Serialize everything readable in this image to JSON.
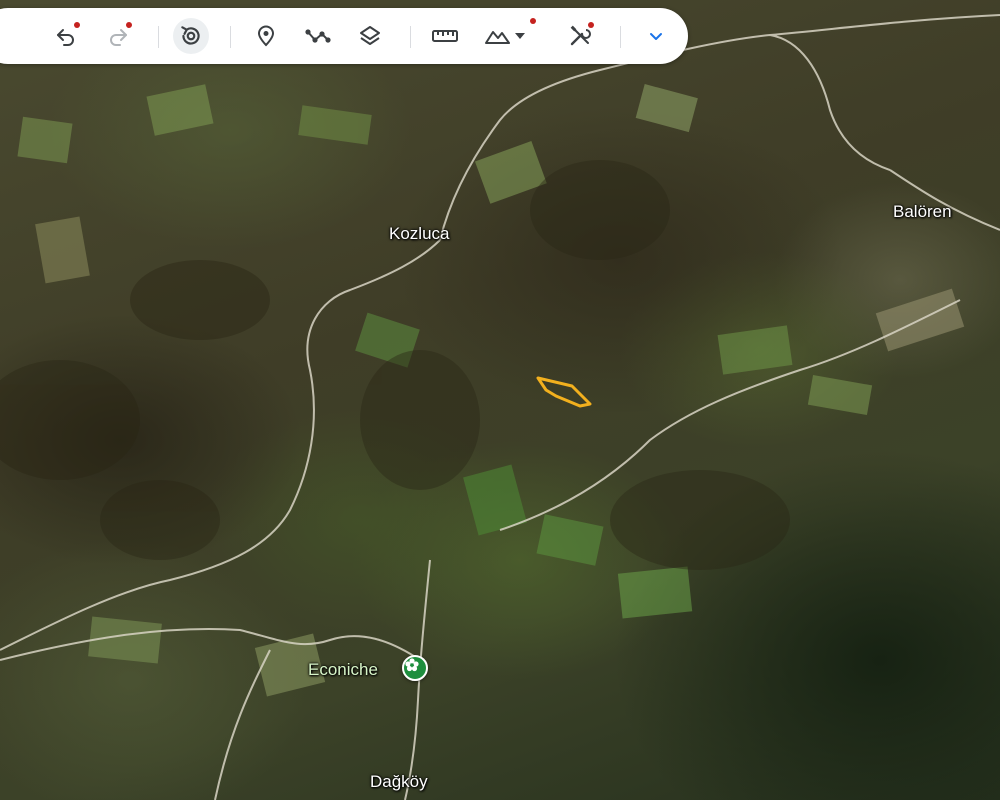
{
  "map": {
    "labels": {
      "kozluca": "Kozluca",
      "baloren": "Balören",
      "econiche": "Econiche",
      "dagkoy": "Dağköy"
    },
    "highlight_color": "#f2b01e",
    "poi_color": "#1e8e3e"
  },
  "toolbar": {
    "undo_icon": "undo-icon",
    "redo_icon": "redo-icon",
    "history_icon": "history-icon",
    "placemark_icon": "map-pin-icon",
    "path_icon": "path-icon",
    "layers_icon": "layers-icon",
    "measure_icon": "ruler-icon",
    "terrain_icon": "terrain-icon",
    "tools_icon": "tools-icon",
    "collapse_icon": "chevron-down-icon",
    "accent_color": "#1a73e8",
    "badge_color": "#c5221f"
  }
}
